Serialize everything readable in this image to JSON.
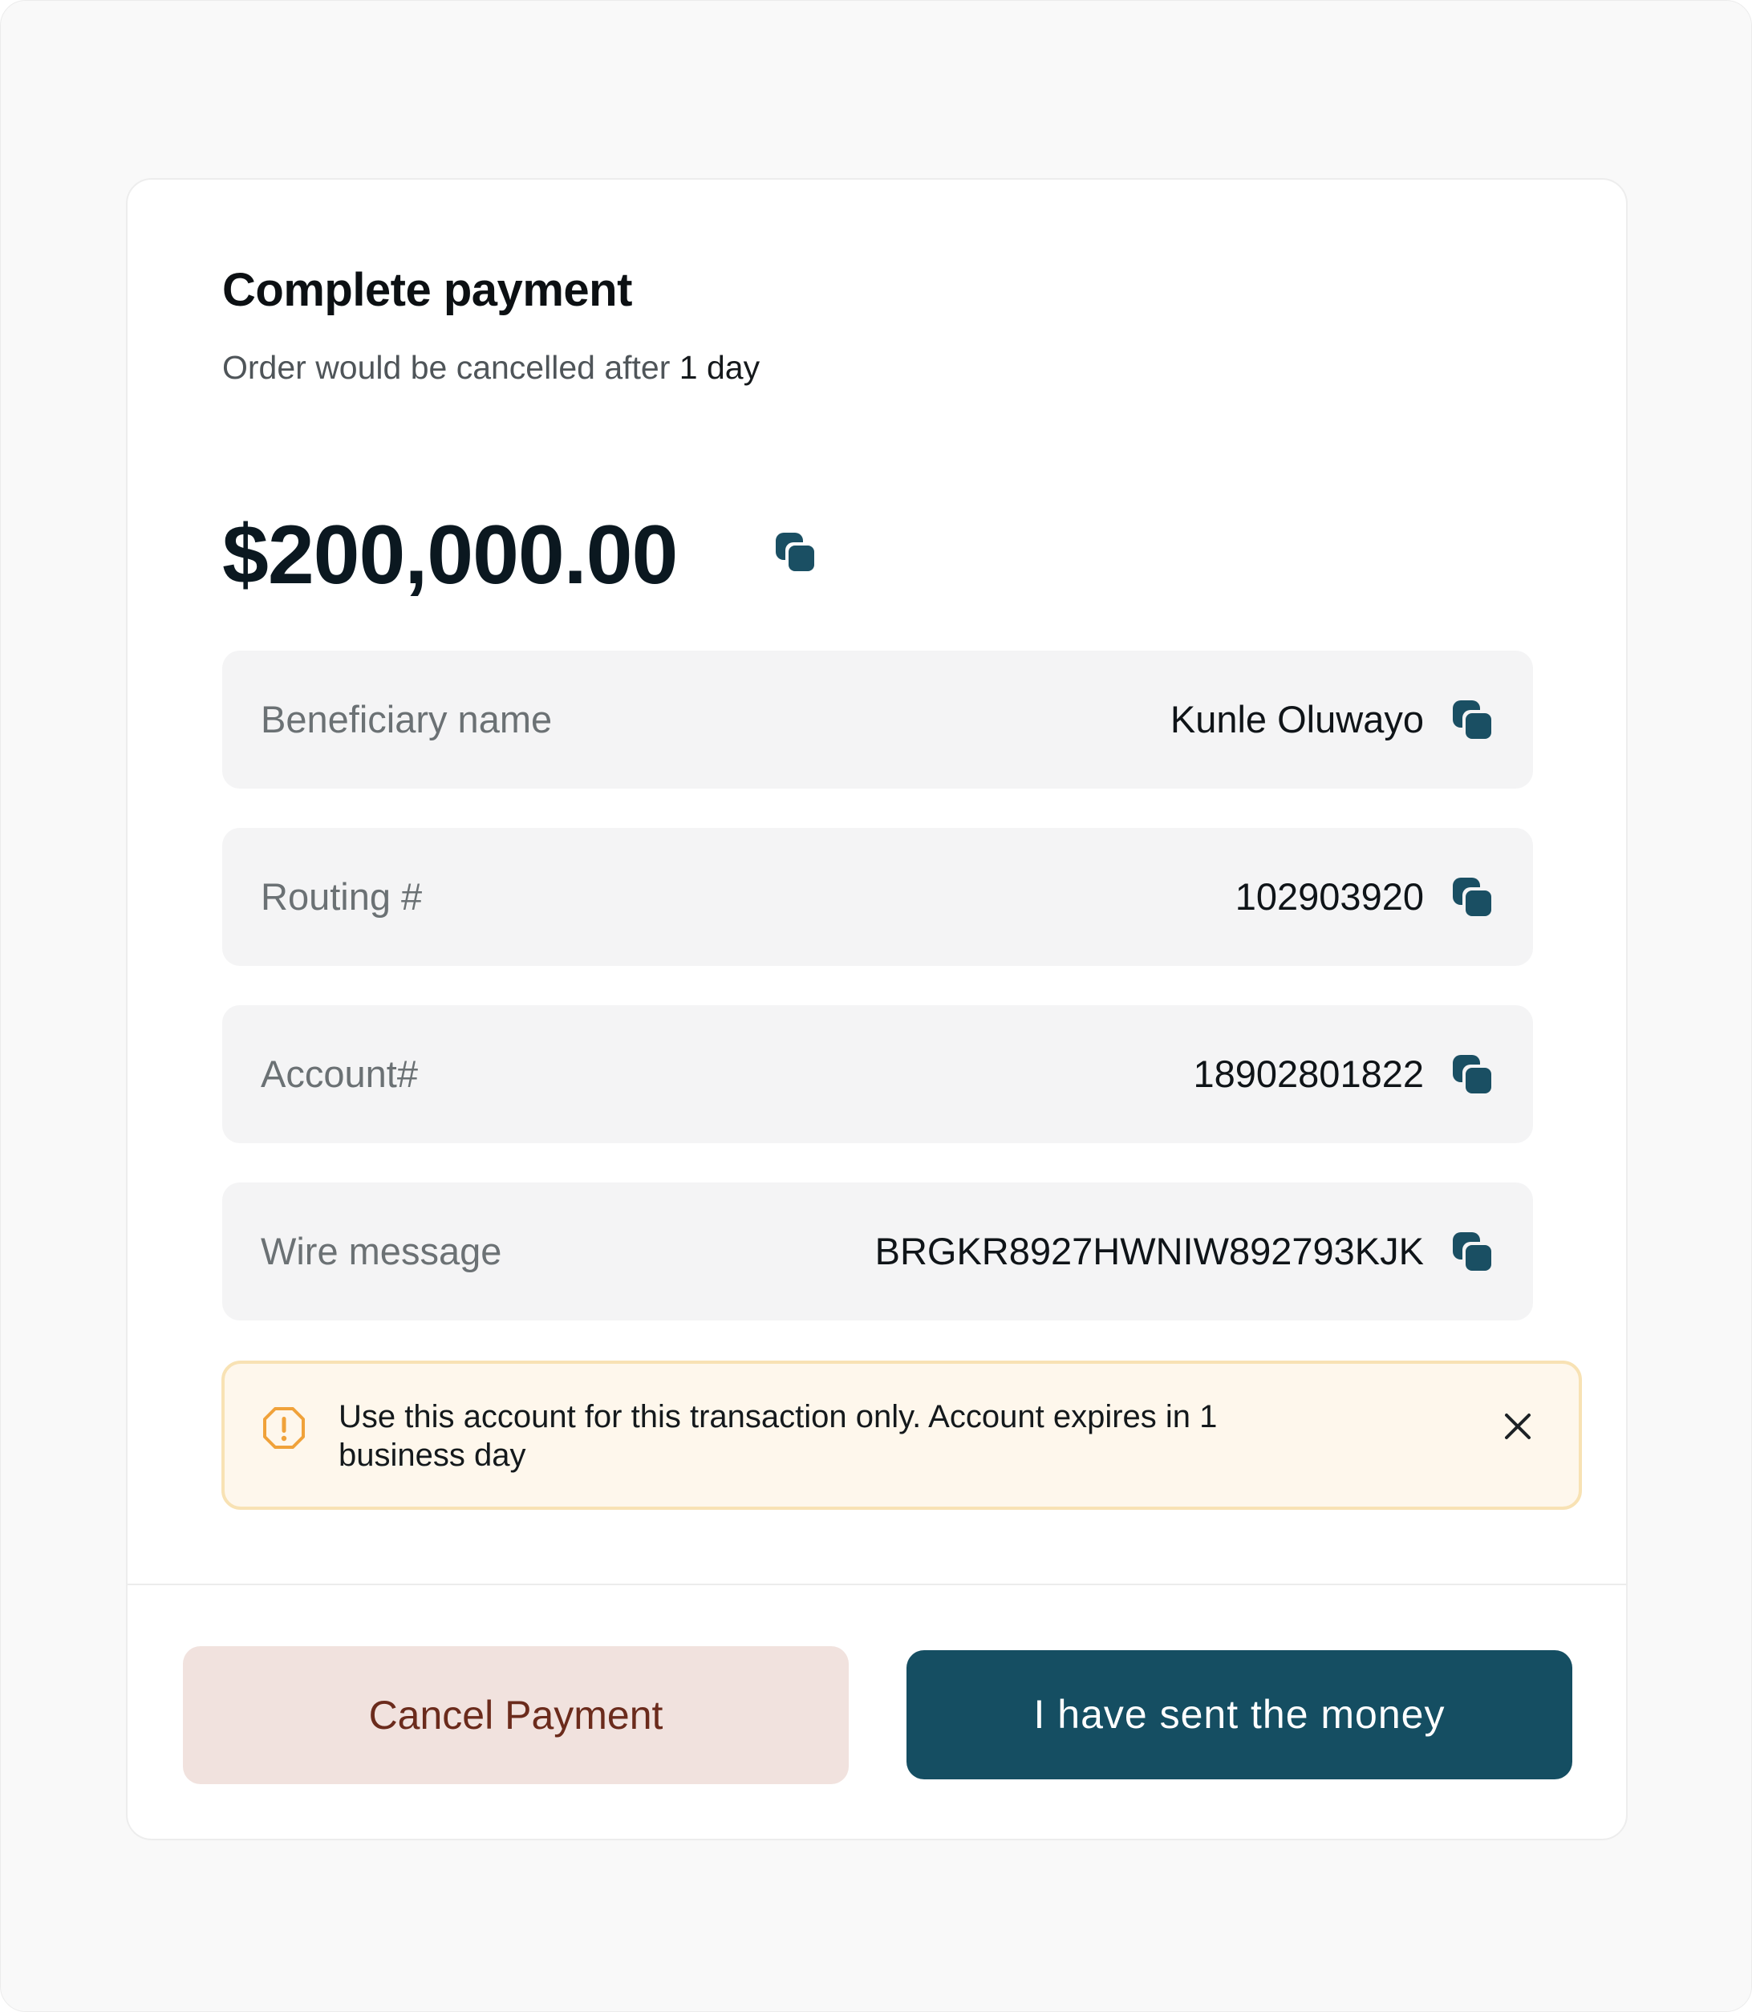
{
  "header": {
    "title": "Complete payment",
    "subtitle_prefix": "Order would be cancelled after ",
    "subtitle_emphasis": "1 day"
  },
  "amount": {
    "value": "$200,000.00",
    "copy_icon": "copy-icon"
  },
  "details": [
    {
      "label": "Beneficiary name",
      "value": "Kunle Oluwayo"
    },
    {
      "label": "Routing #",
      "value": "102903920"
    },
    {
      "label": "Account#",
      "value": "18902801822"
    },
    {
      "label": "Wire message",
      "value": "BRGKR8927HWNIW892793KJK"
    }
  ],
  "alert": {
    "icon": "warning-icon",
    "message": "Use this account for this transaction only. Account expires in 1 business day",
    "close_icon": "close-icon"
  },
  "actions": {
    "cancel_label": "Cancel Payment",
    "confirm_label": "I have sent the money"
  },
  "colors": {
    "primary": "#154e62",
    "icon": "#1a4f63",
    "cancel_bg": "#f1e2de",
    "cancel_text": "#6b2b1c",
    "alert_bg": "#fef7ec",
    "alert_border": "#f8e2b4",
    "warning": "#f0a23a"
  }
}
